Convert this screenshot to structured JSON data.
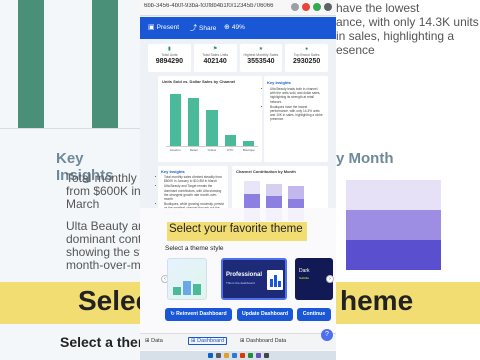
{
  "browser": {
    "url": "6bb-3456-4b0f-93ba-fc0f8b4b1f0/12345b706066",
    "icon_names": [
      "reload-icon",
      "extension-icon",
      "profile-icon",
      "menu-icon"
    ]
  },
  "toolbar": {
    "present_label": "Present",
    "share_label": "Share",
    "zoom_label": "49%"
  },
  "kpis": [
    {
      "icon": "chart-icon",
      "label": "Total Units",
      "value": "9894290"
    },
    {
      "icon": "flag-icon",
      "label": "Total Sales Units",
      "value": "402140"
    },
    {
      "icon": "star-icon",
      "label": "Highest Monthly Sales",
      "value": "3553540"
    },
    {
      "icon": "people-icon",
      "label": "Top Brand Sales",
      "value": "2930250"
    }
  ],
  "chart_units": {
    "title": "Units Sold vs. Dollar Sales by Channel",
    "categories": [
      "Amazon",
      "Retail",
      "Online",
      "DTC",
      "Boutique"
    ],
    "values": [
      92,
      86,
      64,
      20,
      9
    ]
  },
  "key_insights": {
    "title": "Key Insights",
    "items": [
      "Ulta Beauty leads both in channel with the units sold, and dollar sales, highlighting its strength at retail network.",
      "Boutiques have the lowest performance, with only 14.3% units and 10K in sales, highlighting a niche presence."
    ]
  },
  "key_insights_bottom": {
    "title": "Key Insights",
    "items": [
      "Total monthly sales climbed steadily from $600K in January to $10.8M in March",
      "Ulta Beauty and Target remain the dominant contributors, with Ulta showing the strongest growth rate month-over-month",
      "Boutiques, while growing modestly, persist as the smallest channel through out the three months"
    ]
  },
  "chart_channel": {
    "title": "Channel Contribution by Month"
  },
  "theme_picker": {
    "banner": "Select your favorite theme",
    "label": "Select a theme style",
    "themes": [
      {
        "name": "Light"
      },
      {
        "name": "Professional",
        "subtitle": "This is the dashboard"
      },
      {
        "name": "Dark",
        "subtitle": "Subtitle"
      }
    ],
    "buttons": {
      "reinvent": "Reinvent Dashboard",
      "update": "Update Dashboard",
      "continue": "Continue"
    }
  },
  "tabs": [
    "Data",
    "Dashboard",
    "Dashboard Data"
  ],
  "background": {
    "left_insights_title": "Key Insights",
    "left_lines": [
      "Total monthly sales c",
      "from $600K in Jan",
      "March",
      "Ulta Beauty and Targe",
      "dominant contributo",
      "showing the strongest",
      "month-over-month",
      "Boutiques, while grow",
      "persist as the smalle",
      "throughout"
    ],
    "right_lines": [
      "have the lowest",
      "ance, with only 14.3K units",
      "in sales, highlighting a",
      "esence"
    ],
    "right_month_title": "y Month",
    "select_left": "Select",
    "select_right": "heme",
    "select_theme": "Select a them"
  },
  "colors": {
    "accent": "#1a57d6",
    "bar": "#4bba9a",
    "banner": "#f2dd73"
  }
}
